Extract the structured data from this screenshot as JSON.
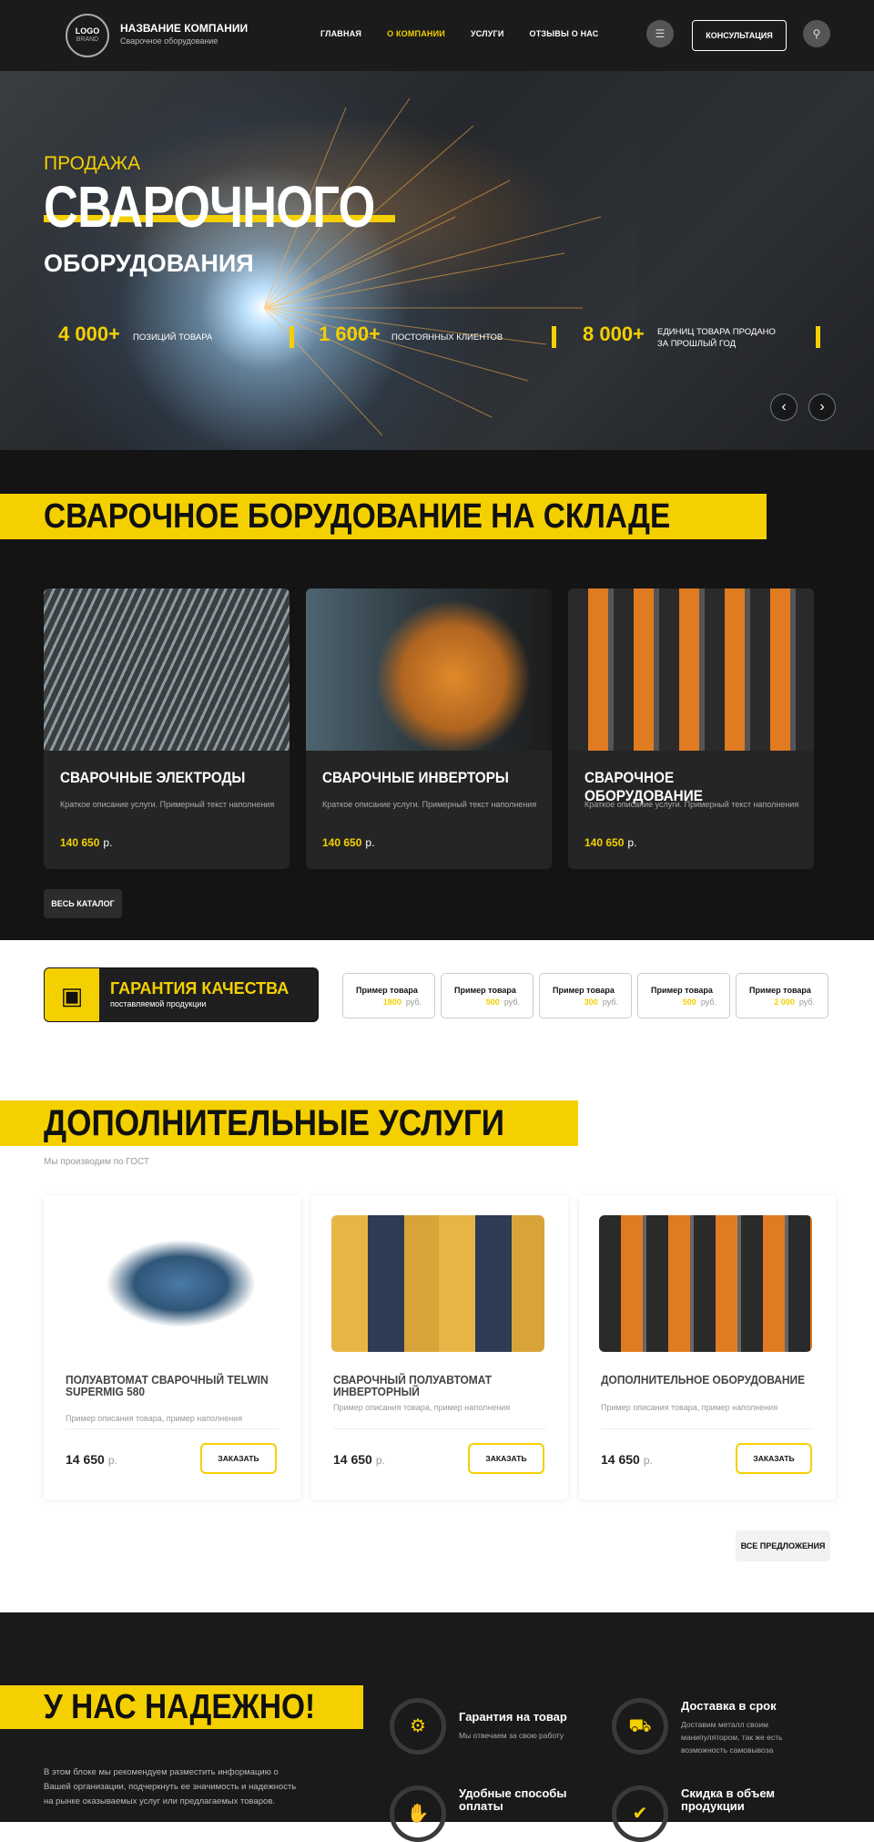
{
  "header": {
    "logo_text": "LOGO",
    "logo_sub": "BRAND",
    "company_name": "НАЗВАНИЕ КОМПАНИИ",
    "company_sub": "Сварочное оборудование",
    "nav": [
      "ГЛАВНАЯ",
      "О КОМПАНИИ",
      "УСЛУГИ",
      "ОТЗЫВЫ О НАС"
    ],
    "active_nav": "О КОМПАНИИ",
    "consult_label": "КОНСУЛЬТАЦИЯ",
    "icons": [
      "menu-icon",
      "location-pin-icon"
    ]
  },
  "hero": {
    "pre": "ПРОДАЖА",
    "title": "СВАРОЧНОГО",
    "subtitle": "ОБОРУДОВАНИЯ",
    "stats": [
      {
        "number": "4 000+",
        "label": "ПОЗИЦИЙ ТОВАРА"
      },
      {
        "number": "1 600+",
        "label": "ПОСТОЯННЫХ КЛИЕНТОВ"
      },
      {
        "number": "8 000+",
        "label": "ЕДИНИЦ ТОВАРА ПРОДАНО ЗА ПРОШЛЫЙ ГОД"
      }
    ]
  },
  "warehouse": {
    "title": "СВАРОЧНОЕ БОРУДОВАНИЕ НА СКЛАДЕ",
    "cards": [
      {
        "title": "СВАРОЧНЫЕ ЭЛЕКТРОДЫ",
        "desc": "Краткое описание услуги. Примерный текст наполнения",
        "price": "140 650",
        "currency": "р."
      },
      {
        "title": "СВАРОЧНЫЕ ИНВЕРТОРЫ",
        "desc": "Краткое описание услуги. Примерный текст наполнения",
        "price": "140 650",
        "currency": "р."
      },
      {
        "title": "СВАРОЧНОЕ ОБОРУДОВАНИЕ",
        "desc": "Краткое описание услуги. Примерный текст наполнения",
        "price": "140 650",
        "currency": "р."
      }
    ],
    "catalog_label": "ВЕСЬ КАТАЛОГ"
  },
  "guarantee": {
    "title": "ГАРАНТИЯ КАЧЕСТВА",
    "subtitle": "поставляемой продукции",
    "products": [
      {
        "name": "Пример товара",
        "price": "1800",
        "currency": "руб."
      },
      {
        "name": "Пример товара",
        "price": "500",
        "currency": "руб."
      },
      {
        "name": "Пример товара",
        "price": "300",
        "currency": "руб."
      },
      {
        "name": "Пример товара",
        "price": "500",
        "currency": "руб."
      },
      {
        "name": "Пример товара",
        "price": "2 000",
        "currency": "руб."
      }
    ]
  },
  "services": {
    "title": "ДОПОЛНИТЕЛЬНЫЕ УСЛУГИ",
    "subtitle": "Мы производим по ГОСТ",
    "cards": [
      {
        "title": "ПОЛУАВТОМАТ СВАРОЧНЫЙ TELWIN SUPERMIG 580",
        "desc": "Пример описания товара, пример наполнения",
        "price": "14 650",
        "currency": "р.",
        "button": "ЗАКАЗАТЬ"
      },
      {
        "title": "СВАРОЧНЫЙ ПОЛУАВТОМАТ ИНВЕРТОРНЫЙ",
        "desc": "Пример описания товара, пример наполнения",
        "price": "14 650",
        "currency": "р.",
        "button": "ЗАКАЗАТЬ"
      },
      {
        "title": "ДОПОЛНИТЕЛЬНОЕ ОБОРУДОВАНИЕ",
        "desc": "Пример описания товара, пример наполнения",
        "price": "14 650",
        "currency": "р.",
        "button": "ЗАКАЗАТЬ"
      }
    ],
    "all_label": "ВСЕ ПРЕДЛОЖЕНИЯ"
  },
  "reliable": {
    "title": "У НАС НАДЕЖНО!",
    "text": "В этом блоке мы рекомендуем разместить информацию о Вашей организации, подчеркнуть ее значимость и надежность на рынке оказываемых услуг или предлагаемых товаров.",
    "features": [
      {
        "title": "Гарантия на товар",
        "desc": "Мы отвечаем за свою работу"
      },
      {
        "title": "Доставка в срок",
        "desc": "Доставим металл своим манипулятором, так же есть возможность самовывоза"
      },
      {
        "title": "Удобные способы оплаты",
        "desc": ""
      },
      {
        "title": "Скидка в объем продукции",
        "desc": ""
      }
    ]
  },
  "colors": {
    "accent": "#f4d000",
    "dark": "#141414"
  }
}
